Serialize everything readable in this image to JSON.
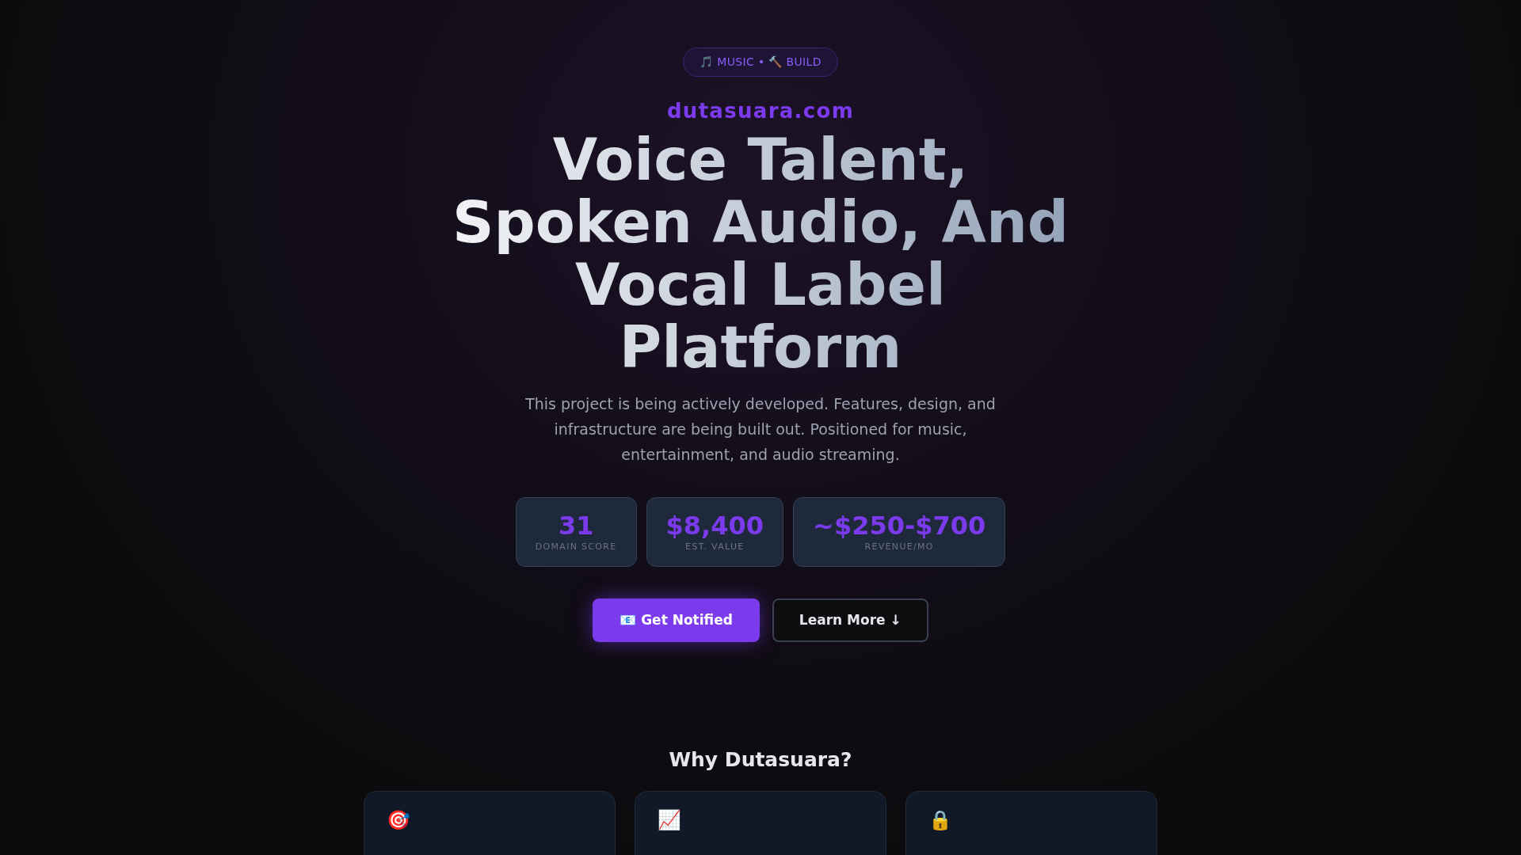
{
  "badge": "🎵 MUSIC • 🔨 BUILD",
  "domain": "dutasuara.com",
  "headline": "Voice Talent, Spoken Audio, And Vocal Label Platform",
  "description": "This project is being actively developed. Features, design, and infrastructure are being built out. Positioned for music, entertainment, and audio streaming.",
  "stats": [
    {
      "value": "31",
      "label": "DOMAIN SCORE"
    },
    {
      "value": "$8,400",
      "label": "EST. VALUE"
    },
    {
      "value": "~$250-$700",
      "label": "REVENUE/MO"
    }
  ],
  "buttons": [
    {
      "kind": "primary",
      "label": "📧 Get Notified"
    },
    {
      "kind": "outline",
      "label": "Learn More ↓"
    }
  ],
  "features": {
    "title": "Why Dutasuara?",
    "cards": [
      {
        "icon": "🎯"
      },
      {
        "icon": "📈"
      },
      {
        "icon": "🔒"
      }
    ]
  }
}
